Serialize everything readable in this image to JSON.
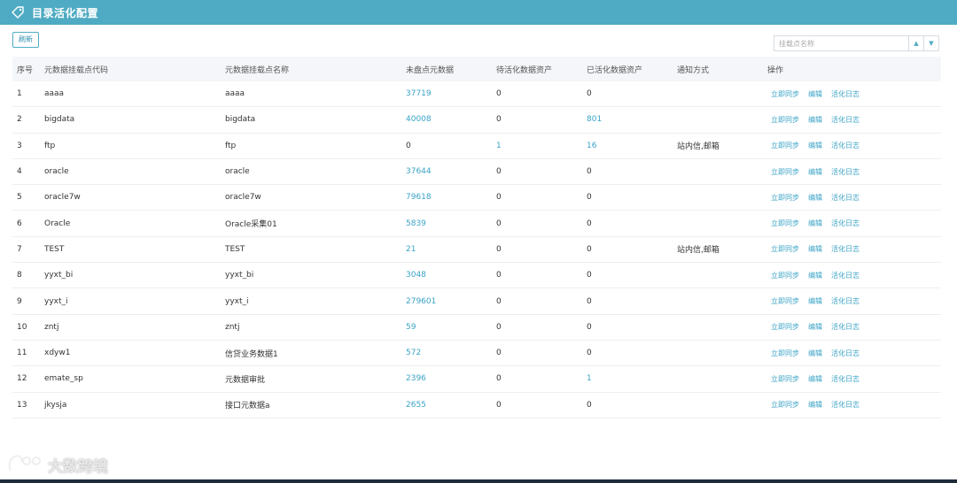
{
  "header": {
    "title": "目录活化配置",
    "icon": "tag-icon",
    "bg_color": "#4fabc3"
  },
  "toolbar": {
    "refresh_label": "刷新",
    "search_placeholder": "挂载点名称"
  },
  "table": {
    "columns": [
      "序号",
      "元数据挂载点代码",
      "元数据挂载点名称",
      "未盘点元数据",
      "待活化数据资产",
      "已活化数据资产",
      "通知方式",
      "操作"
    ],
    "actions": [
      "立即同步",
      "编辑",
      "活化日志"
    ],
    "rows": [
      {
        "no": "1",
        "code": "aaaa",
        "name": "aaaa",
        "unchecked": "37719",
        "pending": "0",
        "activated": "0",
        "notify": ""
      },
      {
        "no": "2",
        "code": "bigdata",
        "name": "bigdata",
        "unchecked": "40008",
        "pending": "0",
        "activated": "801",
        "notify": ""
      },
      {
        "no": "3",
        "code": "ftp",
        "name": "ftp",
        "unchecked": "0",
        "pending": "1",
        "activated": "16",
        "notify": "站内信,邮箱"
      },
      {
        "no": "4",
        "code": "oracle",
        "name": "oracle",
        "unchecked": "37644",
        "pending": "0",
        "activated": "0",
        "notify": ""
      },
      {
        "no": "5",
        "code": "oracle7w",
        "name": "oracle7w",
        "unchecked": "79618",
        "pending": "0",
        "activated": "0",
        "notify": ""
      },
      {
        "no": "6",
        "code": "Oracle",
        "name": "Oracle采集01",
        "unchecked": "5839",
        "pending": "0",
        "activated": "0",
        "notify": ""
      },
      {
        "no": "7",
        "code": "TEST",
        "name": "TEST",
        "unchecked": "21",
        "pending": "0",
        "activated": "0",
        "notify": "站内信,邮箱"
      },
      {
        "no": "8",
        "code": "yyxt_bi",
        "name": "yyxt_bi",
        "unchecked": "3048",
        "pending": "0",
        "activated": "0",
        "notify": ""
      },
      {
        "no": "9",
        "code": "yyxt_i",
        "name": "yyxt_i",
        "unchecked": "279601",
        "pending": "0",
        "activated": "0",
        "notify": ""
      },
      {
        "no": "10",
        "code": "zntj",
        "name": "zntj",
        "unchecked": "59",
        "pending": "0",
        "activated": "0",
        "notify": ""
      },
      {
        "no": "11",
        "code": "xdyw1",
        "name": "信贷业务数据1",
        "unchecked": "572",
        "pending": "0",
        "activated": "0",
        "notify": ""
      },
      {
        "no": "12",
        "code": "emate_sp",
        "name": "元数据审批",
        "unchecked": "2396",
        "pending": "0",
        "activated": "1",
        "notify": ""
      },
      {
        "no": "13",
        "code": "jkysja",
        "name": "接口元数据a",
        "unchecked": "2655",
        "pending": "0",
        "activated": "0",
        "notify": ""
      }
    ]
  },
  "watermark": {
    "text": "大数跨境"
  },
  "colors": {
    "accent": "#4fabc3",
    "link": "#3aa3c6"
  }
}
